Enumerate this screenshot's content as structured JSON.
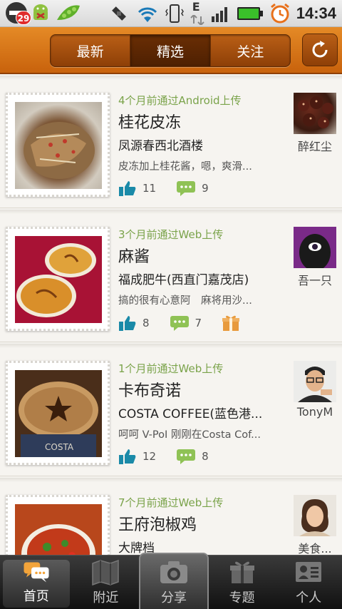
{
  "statusbar": {
    "calendar_badge": "29",
    "clock": "14:34",
    "icons": [
      "calendar-icon",
      "android-icon",
      "peas-icon",
      "satellite-icon",
      "wifi-icon",
      "vibrate-icon",
      "edge-data-icon",
      "signal-icon",
      "battery-icon",
      "alarm-icon"
    ],
    "network_letter": "E"
  },
  "header": {
    "tabs": [
      {
        "label": "最新"
      },
      {
        "label": "精选",
        "active": true
      },
      {
        "label": "关注"
      }
    ]
  },
  "feed": [
    {
      "meta": "4个月前通过Android上传",
      "title": "桂花皮冻",
      "place": "凤源春西北酒楼",
      "desc": "皮冻加上桂花酱，嗯，爽滑...",
      "likes": "11",
      "comments": "9",
      "gift": false,
      "user": "醉红尘"
    },
    {
      "meta": "3个月前通过Web上传",
      "title": "麻酱",
      "place": "福成肥牛(西直门嘉茂店)",
      "desc": "搞的很有心意阿　麻将用沙...",
      "likes": "8",
      "comments": "7",
      "gift": true,
      "user": "吾一只"
    },
    {
      "meta": "1个月前通过Web上传",
      "title": "卡布奇诺",
      "place": "COSTA COFFEE(蓝色港...",
      "desc": "呵呵 V-PoI 刚刚在Costa Cof...",
      "likes": "12",
      "comments": "8",
      "gift": false,
      "user": "TonyM"
    },
    {
      "meta": "7个月前通过Web上传",
      "title": "王府泡椒鸡",
      "place": "大牌档",
      "desc": "",
      "likes": "",
      "comments": "",
      "gift": false,
      "user": "美食..."
    }
  ],
  "tabbar": {
    "items": [
      {
        "label": "首页",
        "icon": "chat-bubbles-icon",
        "active": true
      },
      {
        "label": "附近",
        "icon": "map-icon"
      },
      {
        "label": "分享",
        "icon": "camera-icon"
      },
      {
        "label": "专题",
        "icon": "gift-icon"
      },
      {
        "label": "个人",
        "icon": "profile-card-icon"
      }
    ]
  },
  "colors": {
    "header_orange": "#d9761a",
    "meta_green": "#7aa34a",
    "like_teal": "#1a8aa8",
    "comment_green": "#8fc255",
    "gift_orange": "#e89a3c"
  }
}
